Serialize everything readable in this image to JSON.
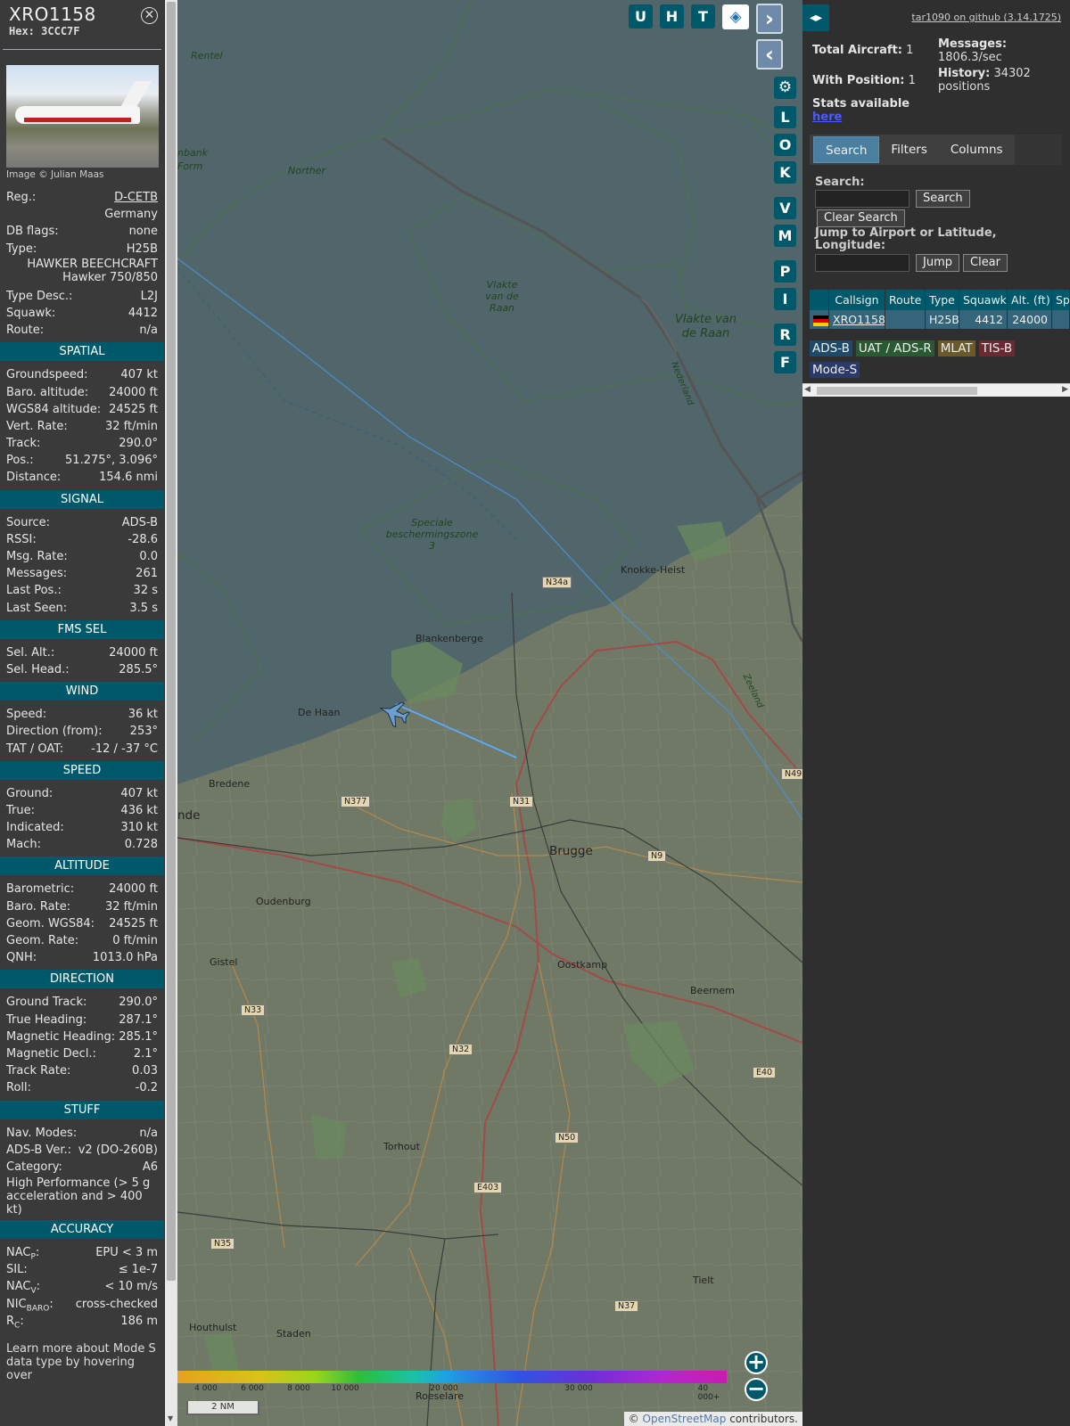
{
  "sidebar": {
    "callsign": "XRO1158",
    "hex_label": "Hex:",
    "hex": "3CCC7F",
    "photo_credit": "Image © Julian Maas",
    "info": [
      {
        "label": "Reg.:",
        "value": "D-CETB",
        "link": true
      },
      {
        "label": "",
        "value": "Germany"
      },
      {
        "label": "DB flags:",
        "value": "none"
      },
      {
        "label": "Type:",
        "value": "H25B"
      }
    ],
    "type_full_1": "HAWKER BEECHCRAFT",
    "type_full_2": "Hawker 750/850",
    "info2": [
      {
        "label": "Type Desc.:",
        "value": "L2J"
      },
      {
        "label": "Squawk:",
        "value": "4412"
      },
      {
        "label": "Route:",
        "value": "n/a"
      }
    ],
    "sections": [
      {
        "title": "SPATIAL",
        "rows": [
          {
            "label": "Groundspeed:",
            "value": "407 kt"
          },
          {
            "label": "Baro. altitude:",
            "value": "24000 ft"
          },
          {
            "label": "WGS84 altitude:",
            "value": "24525 ft"
          },
          {
            "label": "Vert. Rate:",
            "value": "32 ft/min"
          },
          {
            "label": "Track:",
            "value": "290.0°"
          },
          {
            "label": "Pos.:",
            "value": "51.275°, 3.096°"
          },
          {
            "label": "Distance:",
            "value": "154.6 nmi"
          }
        ]
      },
      {
        "title": "SIGNAL",
        "rows": [
          {
            "label": "Source:",
            "value": "ADS-B"
          },
          {
            "label": "RSSI:",
            "value": "-28.6"
          },
          {
            "label": "Msg. Rate:",
            "value": "0.0"
          },
          {
            "label": "Messages:",
            "value": "261"
          },
          {
            "label": "Last Pos.:",
            "value": "32 s"
          },
          {
            "label": "Last Seen:",
            "value": "3.5 s"
          }
        ]
      },
      {
        "title": "FMS SEL",
        "rows": [
          {
            "label": "Sel. Alt.:",
            "value": "24000 ft"
          },
          {
            "label": "Sel. Head.:",
            "value": "285.5°"
          }
        ]
      },
      {
        "title": "WIND",
        "rows": [
          {
            "label": "Speed:",
            "value": "36 kt"
          },
          {
            "label": "Direction (from):",
            "value": "253°"
          },
          {
            "label": "TAT / OAT:",
            "value": "-12 / -37 °C"
          }
        ]
      },
      {
        "title": "SPEED",
        "rows": [
          {
            "label": "Ground:",
            "value": "407 kt"
          },
          {
            "label": "True:",
            "value": "436 kt"
          },
          {
            "label": "Indicated:",
            "value": "310 kt"
          },
          {
            "label": "Mach:",
            "value": "0.728"
          }
        ]
      },
      {
        "title": "ALTITUDE",
        "rows": [
          {
            "label": "Barometric:",
            "value": "24000 ft"
          },
          {
            "label": "Baro. Rate:",
            "value": "32 ft/min"
          },
          {
            "label": "Geom. WGS84:",
            "value": "24525 ft"
          },
          {
            "label": "Geom. Rate:",
            "value": "0 ft/min"
          },
          {
            "label": "QNH:",
            "value": "1013.0 hPa"
          }
        ]
      },
      {
        "title": "DIRECTION",
        "rows": [
          {
            "label": "Ground Track:",
            "value": "290.0°"
          },
          {
            "label": "True Heading:",
            "value": "287.1°"
          },
          {
            "label": "Magnetic Heading:",
            "value": "285.1°"
          },
          {
            "label": "Magnetic Decl.:",
            "value": "2.1°"
          },
          {
            "label": "Track Rate:",
            "value": "0.03"
          },
          {
            "label": "Roll:",
            "value": "-0.2"
          }
        ]
      },
      {
        "title": "STUFF",
        "rows": [
          {
            "label": "Nav. Modes:",
            "value": "n/a"
          },
          {
            "label": "ADS-B Ver.:",
            "value": "v2 (DO-260B)"
          },
          {
            "label": "Category:",
            "value": "A6"
          }
        ]
      }
    ],
    "category_desc": "High Performance (> 5 g acceleration and > 400 kt)",
    "accuracy_title": "ACCURACY",
    "accuracy": [
      {
        "label": "NAC",
        "sub": "P",
        "suffix": ":",
        "value": "EPU < 3 m"
      },
      {
        "label": "SIL:",
        "sub": "",
        "suffix": "",
        "value": "≤ 1e-7"
      },
      {
        "label": "NAC",
        "sub": "V",
        "suffix": ":",
        "value": "< 10 m/s"
      },
      {
        "label": "NIC",
        "sub": "BARO",
        "suffix": ":",
        "value": "cross-checked"
      },
      {
        "label": "R",
        "sub": "C",
        "suffix": ":",
        "value": "186 m"
      }
    ],
    "learn_more": "Learn more about Mode S data type by hovering over"
  },
  "map": {
    "top_buttons": [
      "U",
      "H",
      "T"
    ],
    "side_buttons": [
      "L",
      "O",
      "K",
      "V",
      "M",
      "P",
      "I",
      "R",
      "F"
    ],
    "labels": {
      "rentel": "Rentel",
      "northern": "Norther",
      "nbank": "nbank",
      "form": "Form",
      "vlakte1": "Vlakte van de Raan",
      "vlakte2": "Vlakte van de Raan",
      "nederland": "Nederland",
      "zeeland": "Zeeland",
      "speciale": "Speciale beschermingszone 3",
      "knokke": "Knokke-Heist",
      "blankenberge": "Blankenberge",
      "dehaan": "De Haan",
      "bredene": "Bredene",
      "brugge": "Brugge",
      "oudenburg": "Oudenburg",
      "gistel": "Gistel",
      "oostkamp": "Oostkamp",
      "beernem": "Beernem",
      "torhout": "Torhout",
      "tielt": "Tielt",
      "houthulst": "Houthulst",
      "staden": "Staden",
      "roeselare": "Roeselare",
      "nde": "nde"
    },
    "roads": {
      "n34a": "N34a",
      "n377": "N377",
      "n31": "N31",
      "n9": "N9",
      "n49": "N49",
      "n33": "N33",
      "n32": "N32",
      "e40": "E40",
      "n50": "N50",
      "e403": "E403",
      "n35": "N35",
      "n37": "N37"
    },
    "altitude_scale": [
      "4 000",
      "6 000",
      "8 000",
      "10 000",
      "20 000",
      "30 000",
      "40 000+"
    ],
    "scale_bar": "2 NM",
    "attribution_prefix": "©",
    "attribution_link": "OpenStreetMap",
    "attribution_suffix": "contributors."
  },
  "panel": {
    "github": "tar1090 on github (3.14.1725)",
    "total_aircraft_label": "Total Aircraft:",
    "total_aircraft": "1",
    "with_position_label": "With Position:",
    "with_position": "1",
    "messages_label": "Messages:",
    "messages": "1806.3/sec",
    "history_label": "History:",
    "history": "34302 positions",
    "stats_label": "Stats available",
    "stats_link": "here",
    "tabs": [
      "Search",
      "Filters",
      "Columns"
    ],
    "search_label": "Search:",
    "search_button": "Search",
    "clear_search": "Clear Search",
    "jump_label": "Jump to Airport or Latitude, Longitude:",
    "jump_button": "Jump",
    "clear_button": "Clear",
    "table_headers": [
      "Callsign",
      "Route",
      "Type",
      "Squawk",
      "Alt. (ft)",
      "Sp"
    ],
    "row": {
      "callsign": "XRO1158",
      "route": "",
      "type": "H25B",
      "squawk": "4412",
      "alt": "24000"
    },
    "badges": [
      {
        "label": "ADS-B",
        "color": "#1e4a6a"
      },
      {
        "label": "UAT / ADS-R",
        "color": "#2a5a32"
      },
      {
        "label": "MLAT",
        "color": "#6a5a2a"
      },
      {
        "label": "TIS-B",
        "color": "#6a2a32"
      },
      {
        "label": "Mode-S",
        "color": "#2a3a6a"
      }
    ]
  }
}
